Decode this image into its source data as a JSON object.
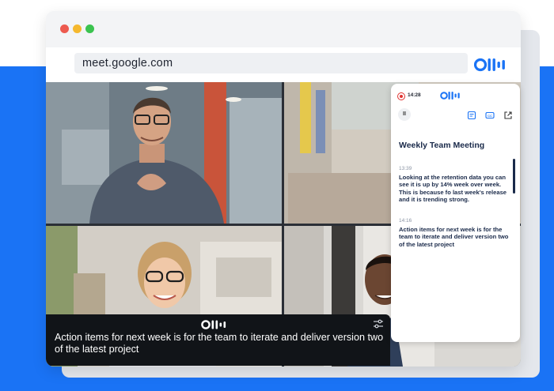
{
  "browser": {
    "url": "meet.google.com",
    "brand_logo": "otter-logo"
  },
  "meeting": {
    "tiles": [
      {
        "name": "participant-man-glasses"
      },
      {
        "name": "participant-woman-red"
      },
      {
        "name": "participant-woman-blonde"
      },
      {
        "name": "participant-man-smiling"
      }
    ]
  },
  "caption": {
    "text": "Action items for next week is for the team to iterate and deliver version two of the latest project",
    "logo": "otter-logo",
    "settings_icon": "settings-sliders-icon"
  },
  "panel": {
    "recording_time": "14:28",
    "title": "Weekly Team Meeting",
    "entries": [
      {
        "time": "13:39",
        "text": "Looking at the retention data you can see it is up by 14% week over week. This is because fo last week's release and it is trending strong."
      },
      {
        "time": "14:16",
        "text": "Action items for next week is for the team to iterate and deliver version two of the latest project"
      }
    ],
    "icons": [
      "pause-icon",
      "notes-icon",
      "caption-icon",
      "open-external-icon"
    ]
  },
  "colors": {
    "brand_blue": "#1a73f5",
    "record_red": "#e0322f",
    "text_navy": "#1a2a4a"
  }
}
